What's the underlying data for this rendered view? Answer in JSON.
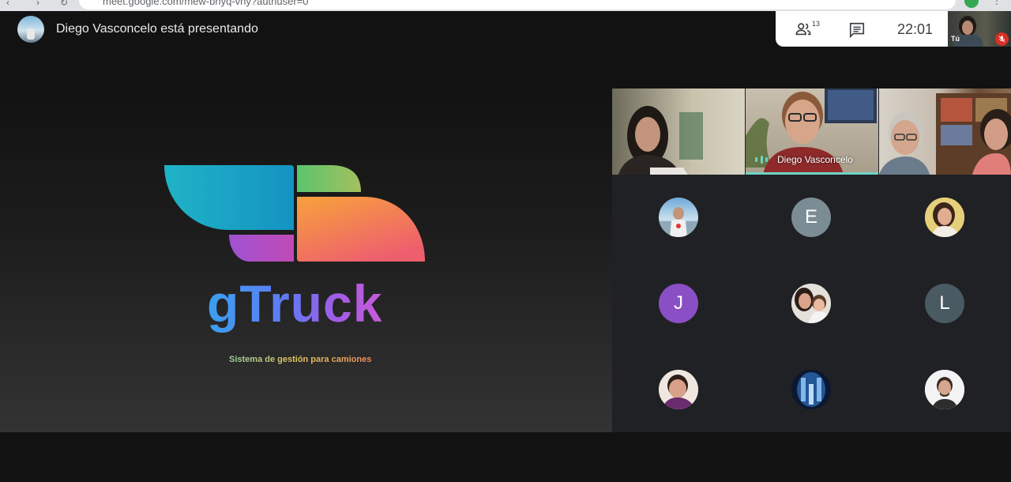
{
  "browser": {
    "url": "meet.google.com/mew-bhyq-vny?authuser=0"
  },
  "presenter_banner": {
    "text": "Diego Vasconcelo está presentando"
  },
  "info_panel": {
    "participant_count": "13",
    "time": "22:01"
  },
  "self_view": {
    "label": "Tú"
  },
  "presentation": {
    "brand": "gTruck",
    "tagline": "Sistema de gestión para camiones"
  },
  "video_tiles": [
    {
      "label": ""
    },
    {
      "label": "Diego Vasconcelo"
    },
    {
      "label": ""
    }
  ],
  "participant_avatars": [
    {
      "type": "photo",
      "initial": ""
    },
    {
      "type": "initial",
      "initial": "E",
      "color": "#7c8c94"
    },
    {
      "type": "photo",
      "initial": ""
    },
    {
      "type": "initial",
      "initial": "J",
      "color": "#8a4fc4"
    },
    {
      "type": "photo",
      "initial": ""
    },
    {
      "type": "initial",
      "initial": "L",
      "color": "#4a5a63"
    },
    {
      "type": "photo",
      "initial": ""
    },
    {
      "type": "photo",
      "initial": ""
    },
    {
      "type": "photo",
      "initial": ""
    }
  ],
  "colors": {
    "accent_speaking": "#6fd3c6",
    "mic_off": "#d93025",
    "panel_bg": "#202124"
  }
}
